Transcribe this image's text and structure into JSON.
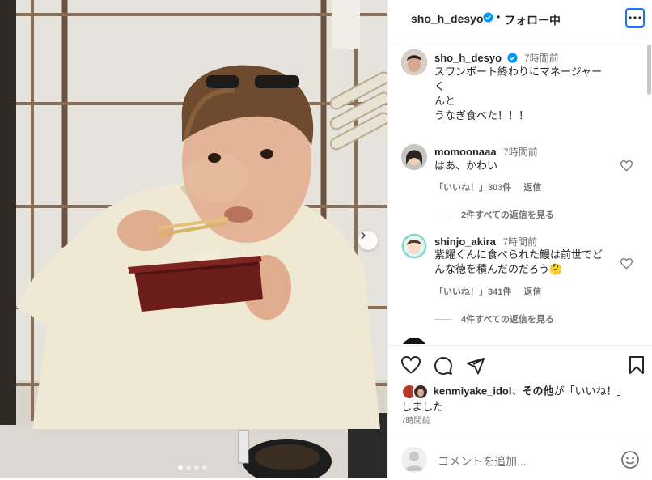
{
  "header": {
    "username": "sho_h_desyo",
    "separator": "•",
    "follow_status": "フォロー中"
  },
  "caption": {
    "username": "sho_h_desyo",
    "time": "7時間前",
    "line1": "スワンボート終わりにマネージャーく",
    "line2": "んと",
    "line3": "うなぎ食べた！！！"
  },
  "comments": [
    {
      "username": "momoonaaa",
      "time": "7時間前",
      "text": "はあ、かわい",
      "likes": "「いいね！」303件",
      "reply": "返信",
      "view_replies": "2件すべての返信を見る"
    },
    {
      "username": "shinjo_akira",
      "time": "7時間前",
      "text_line1": "紫耀くんに食べられた鰻は前世でど",
      "text_line2": "んな徳を積んだのだろう🤔",
      "likes": "「いいね！」341件",
      "reply": "返信",
      "view_replies": "4件すべての返信を見る"
    }
  ],
  "liked_by": {
    "user": "kenmiyake_idol",
    "sep": "、",
    "others": "その他",
    "suffix1": "が「いいね！」",
    "suffix2": "しました"
  },
  "post_time": "7時間前",
  "comment_input": {
    "placeholder": "コメントを追加..."
  },
  "carousel": {
    "slide_count": 4,
    "active_index": 0
  },
  "colors": {
    "verified": "#0095f6",
    "accent_outline": "#1877f2"
  }
}
